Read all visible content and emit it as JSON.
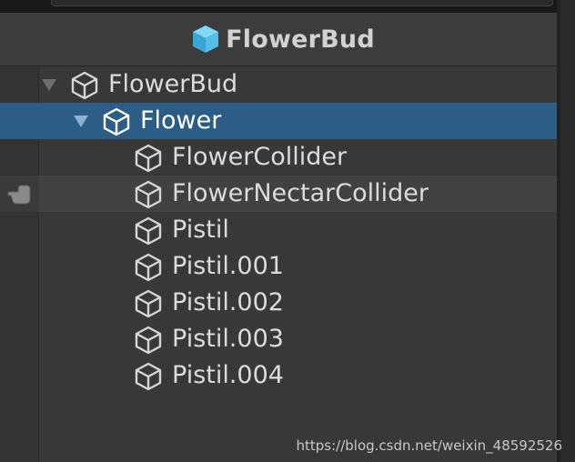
{
  "header": {
    "title": "FlowerBud",
    "icon": "cube-icon",
    "icon_color": "#4fc1e9"
  },
  "tree": [
    {
      "label": "FlowerBud",
      "depth": 0,
      "expanded": true,
      "selected": false
    },
    {
      "label": "Flower",
      "depth": 1,
      "expanded": true,
      "selected": true
    },
    {
      "label": "FlowerCollider",
      "depth": 2
    },
    {
      "label": "FlowerNectarCollider",
      "depth": 2,
      "hovered": true
    },
    {
      "label": "Pistil",
      "depth": 2
    },
    {
      "label": "Pistil.001",
      "depth": 2
    },
    {
      "label": "Pistil.002",
      "depth": 2
    },
    {
      "label": "Pistil.003",
      "depth": 2
    },
    {
      "label": "Pistil.004",
      "depth": 2
    }
  ],
  "colors": {
    "selection": "#2c5d87",
    "background": "#383838",
    "header": "#3c3c3c"
  },
  "watermark": "https://blog.csdn.net/weixin_48592526"
}
